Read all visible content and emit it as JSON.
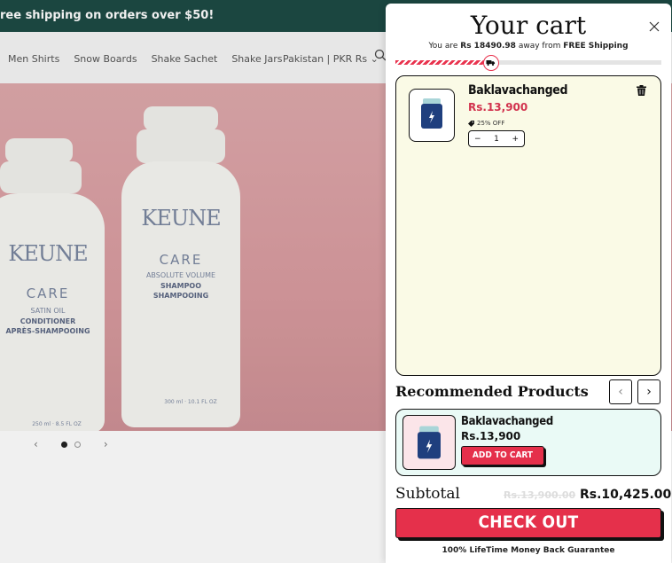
{
  "announcement": {
    "text": "ree shipping on orders over $50!"
  },
  "nav": {
    "links": [
      "Men Shirts",
      "Snow Boards",
      "Shake Sachet",
      "Shake Jars"
    ],
    "country": "Pakistan | PKR Rs"
  },
  "hero": {
    "brand": "KEUNE",
    "left_bottle": {
      "line1": "CARE",
      "line2": "SATIN OIL",
      "line3": "CONDITIONER",
      "line4": "APRÈS-SHAMPOOING",
      "volume": "250 ml · 8.5 FL OZ"
    },
    "right_bottle": {
      "line1": "CARE",
      "line2": "ABSOLUTE VOLUME",
      "line3": "SHAMPOO",
      "line4": "SHAMPOOING",
      "volume": "300 ml · 10.1 FL OZ"
    },
    "slide_count": 2,
    "active_slide": 1
  },
  "cart": {
    "title": "Your cart",
    "shipping": {
      "prefix": "You are",
      "amount": "Rs 18490.98",
      "middle": "away from",
      "target": "FREE Shipping",
      "progress": 0.35
    },
    "item": {
      "name": "Baklavachanged",
      "price": "Rs.13,900",
      "discount": "25% OFF",
      "quantity": "1"
    },
    "recommended": {
      "title": "Recommended Products",
      "item": {
        "name": "Baklavachanged",
        "price": "Rs.13,900",
        "button": "ADD TO CART"
      }
    },
    "subtotal": {
      "label": "Subtotal",
      "original": "Rs.13,900.00",
      "current": "Rs.10,425.00"
    },
    "checkout_label": "CHECK OUT",
    "guarantee": "100% LifeTime Money Back Guarantee"
  },
  "colors": {
    "accent": "#e5304b",
    "announcement_bg": "#1d4b45",
    "cart_box_bg": "#fafae6",
    "rec_box_bg": "#eafaf6"
  }
}
